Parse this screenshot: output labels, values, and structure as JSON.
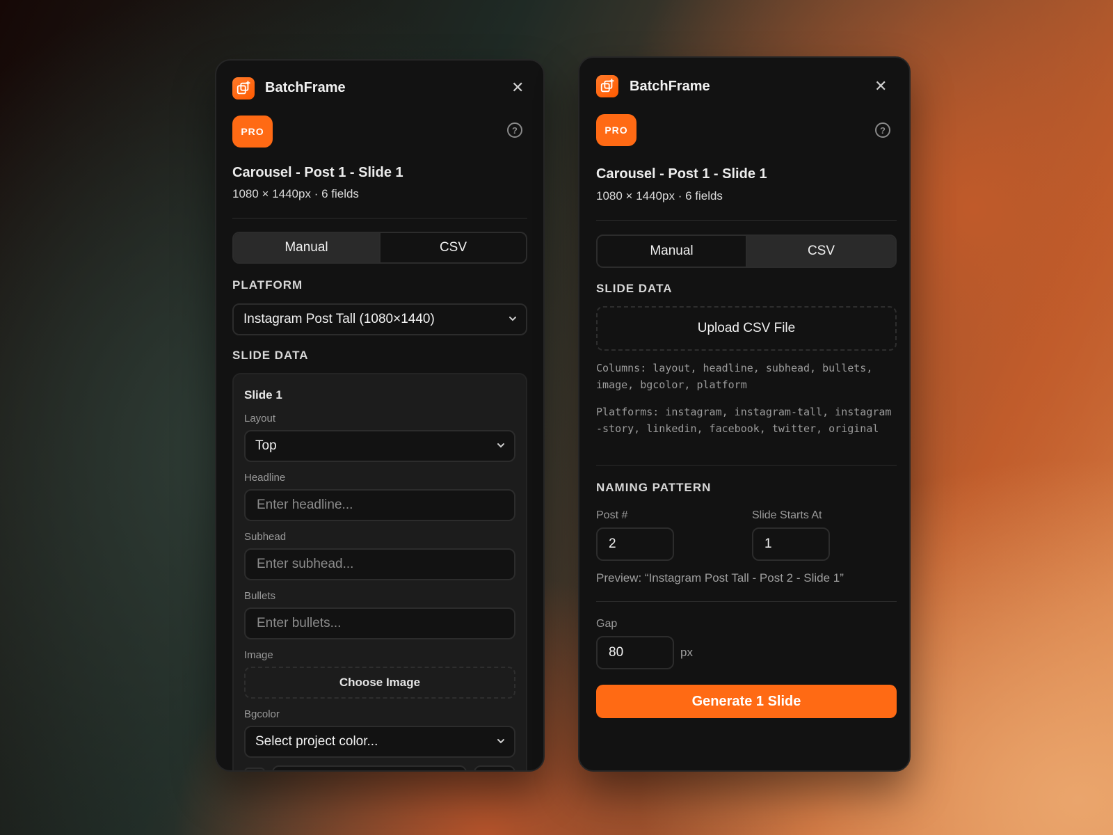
{
  "brand": "BatchFrame",
  "pro_badge": "PRO",
  "close_glyph": "✕",
  "help_glyph": "?",
  "template": {
    "title": "Carousel - Post 1 - Slide 1",
    "meta": "1080 × 1440px · 6 fields"
  },
  "tabs": {
    "manual": "Manual",
    "csv": "CSV"
  },
  "left": {
    "platform_label": "PLATFORM",
    "platform_value": "Instagram Post Tall (1080×1440)",
    "slide_data_label": "SLIDE DATA",
    "slide": {
      "title": "Slide 1",
      "layout_label": "Layout",
      "layout_value": "Top",
      "headline_label": "Headline",
      "headline_placeholder": "Enter headline...",
      "subhead_label": "Subhead",
      "subhead_placeholder": "Enter subhead...",
      "bullets_label": "Bullets",
      "bullets_placeholder": "Enter bullets...",
      "image_label": "Image",
      "image_button": "Choose Image",
      "bgcolor_label": "Bgcolor",
      "bgcolor_value": "Select project color..."
    }
  },
  "right": {
    "slide_data_label": "SLIDE DATA",
    "upload_button": "Upload CSV File",
    "columns_text": "Columns: layout, headline, subhead, bullets, image, bgcolor, platform",
    "platforms_text": "Platforms: instagram, instagram-tall, instagram-story, linkedin, facebook, twitter, original",
    "naming_label": "NAMING PATTERN",
    "post_label": "Post #",
    "post_value": "2",
    "slide_start_label": "Slide Starts At",
    "slide_start_value": "1",
    "preview": "Preview: “Instagram Post Tall - Post 2 - Slide 1”",
    "gap_label": "Gap",
    "gap_value": "80",
    "gap_unit": "px",
    "generate_button": "Generate 1 Slide"
  },
  "colors": {
    "accent": "#ff6a14",
    "panel": "#121212",
    "card": "#1c1c1c"
  },
  "icons": {
    "logo": "layers-plus-icon",
    "close": "close-icon",
    "help": "help-icon",
    "dropdown": "chevron-down-icon"
  }
}
